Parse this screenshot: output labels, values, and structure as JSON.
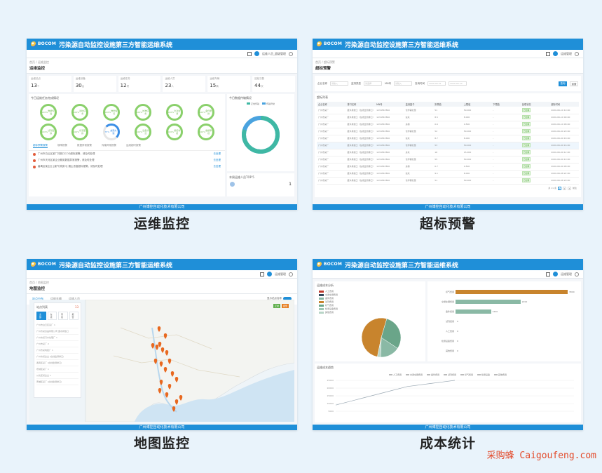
{
  "app_title": "污染源自动监控设施第三方智能运维系统",
  "logo_text": "BOCOM",
  "footer_text": "广州博控自动化技术有限公司",
  "watermark": "采购蜂 Caigoufeng.com",
  "panels": [
    {
      "caption": "运维监控",
      "breadcrumb": "首页 / 运维监控",
      "page_title": "运维监控",
      "user_name": "运维人员_超级管理",
      "stats": [
        {
          "label": "运维站点",
          "value": "13",
          "unit": "个"
        },
        {
          "label": "运维设备",
          "value": "30",
          "unit": "台"
        },
        {
          "label": "运维任务",
          "value": "12",
          "unit": "项"
        },
        {
          "label": "运维人员",
          "value": "23",
          "unit": "人"
        },
        {
          "label": "运维车辆",
          "value": "15",
          "unit": "辆"
        },
        {
          "label": "巡检次数",
          "value": "44",
          "unit": "次"
        }
      ],
      "rings_title": "今日运维任务完成情况",
      "rings": [
        {
          "pct": "100%",
          "label": "数据传输"
        },
        {
          "pct": "100%",
          "label": "巡检任务"
        },
        {
          "pct": "100%",
          "label": "维修保养"
        },
        {
          "pct": "100%",
          "label": "校准任务"
        },
        {
          "pct": "100%",
          "label": "比对监测"
        },
        {
          "pct": "100%",
          "label": "备件更换"
        },
        {
          "pct": "100%",
          "label": "试剂更换"
        },
        {
          "pct": "100%",
          "label": "标液更换"
        },
        {
          "pct": "75%",
          "label": "故障处理"
        },
        {
          "pct": "100%",
          "label": "设备清洗"
        },
        {
          "pct": "100%",
          "label": "质控考核"
        },
        {
          "pct": "100%",
          "label": "数据审核"
        }
      ],
      "donut_title": "今日数据传输情况",
      "donut_legend": [
        "正常传输",
        "传输异常"
      ],
      "rank_title": "本周运维人员TOP 5",
      "rank_value": "1",
      "tabs": [
        "超标预警报警",
        "故障报警",
        "数据异常报警",
        "传输异常报警",
        "运维超时报警"
      ],
      "alarms": [
        {
          "text": "广州市白云区某厂排放口COD超标报警，请及时处理",
          "link": "去处理"
        },
        {
          "text": "广州市天河区某企业氨氮数据异常报警，请及时处理",
          "link": "去处理"
        },
        {
          "text": "番禺区某企业 [废气排放口] 烟尘浓度超标报警，请及时处理",
          "link": "去处理"
        }
      ]
    },
    {
      "caption": "超标预警",
      "breadcrumb": "首页 / 超标预警",
      "page_title": "超标预警",
      "user_name": "运维管理",
      "filters": [
        {
          "label": "企业名称",
          "placeholder": "请输入"
        },
        {
          "label": "监测类型",
          "placeholder": "请选择"
        },
        {
          "label": "MN号",
          "placeholder": "请输入"
        },
        {
          "label": "查询时间",
          "placeholder": "2020-06-01"
        }
      ],
      "date_end": "2020-06-10",
      "search_btn": "查询",
      "reset_btn": "重置",
      "table_title": "超标列表",
      "columns": [
        "企业名称",
        "排口名称",
        "MN号",
        "监测因子",
        "折算值",
        "上限值",
        "下限值",
        "处理状态",
        "超标时间"
      ],
      "rows": [
        [
          "广州市某厂",
          "废水排放口（在线监测排口）",
          "1234567890",
          "化学需氧量",
          "51",
          "50.000",
          "-",
          "已处理",
          "2020-06-10 10:00"
        ],
        [
          "广州市某厂",
          "废水排放口（在线监测排口）",
          "1234567890",
          "氨氮",
          "8.5",
          "8.000",
          "-",
          "已处理",
          "2020-06-10 09:00"
        ],
        [
          "广州市某厂",
          "废水排放口（在线监测排口）",
          "1234567890",
          "总磷",
          "0.6",
          "0.500",
          "-",
          "已处理",
          "2020-06-10 08:00"
        ],
        [
          "广州市某厂",
          "废水排放口（在线监测排口）",
          "1234567890",
          "化学需氧量",
          "52",
          "50.000",
          "-",
          "已处理",
          "2020-06-09 20:00"
        ],
        [
          "广州市某厂",
          "废水排放口（在线监测排口）",
          "1234567890",
          "氨氮",
          "8.7",
          "8.000",
          "-",
          "已处理",
          "2020-06-09 18:00"
        ],
        [
          "广州市某厂",
          "废水排放口（在线监测排口）",
          "1234567890",
          "化学需氧量",
          "53",
          "50.000",
          "-",
          "已处理",
          "2020-06-09 16:00"
        ],
        [
          "广州市某厂",
          "废水排放口（在线监测排口）",
          "1234567890",
          "总氮",
          "16",
          "15.000",
          "-",
          "已处理",
          "2020-06-09 12:00"
        ],
        [
          "广州市某厂",
          "废水排放口（在线监测排口）",
          "1234567890",
          "化学需氧量",
          "55",
          "50.000",
          "-",
          "已处理",
          "2020-06-09 10:00"
        ],
        [
          "广州市某厂",
          "废水排放口（在线监测排口）",
          "1234567890",
          "总磷",
          "0.7",
          "0.500",
          "-",
          "已处理",
          "2020-06-09 08:00"
        ],
        [
          "广州市某厂",
          "废水排放口（在线监测排口）",
          "1234567890",
          "氨氮",
          "9.1",
          "8.000",
          "-",
          "已处理",
          "2020-06-08 22:00"
        ],
        [
          "广州市某厂",
          "废水排放口（在线监测排口）",
          "1234567890",
          "化学需氧量",
          "51",
          "50.000",
          "-",
          "已处理",
          "2020-06-08 20:00"
        ]
      ],
      "pager_total": "共 11 条",
      "pager_pages": [
        "1",
        "2",
        "3"
      ],
      "pager_jump": "前往"
    },
    {
      "caption": "地图监控",
      "breadcrumb": "首页 / 地图监控",
      "page_title": "地图监控",
      "user_name": "运维管理",
      "tabs": [
        "站点分布",
        "运维车辆",
        "运维人员"
      ],
      "toggle_label": "显示站点名称",
      "list_title": "站点列表",
      "list_count": "13",
      "list_tabs": [
        "全部",
        "在线",
        "离线",
        "报警"
      ],
      "list_items": [
        "广州市白云区某厂 1",
        "广州市某食品有限公司 废水排放口",
        "广州市某污水处理厂 1",
        "广州市某厂 2",
        "广州市某电镀厂 1",
        "广州市某企业 (在线监测排口)",
        "番禺区某厂 (在线监测排口)",
        "增城区某厂 1",
        "从化区某企业 1",
        "黄埔区某厂 (在线监测排口)"
      ],
      "map_btns": [
        "正常",
        "报警"
      ]
    },
    {
      "caption": "成本统计",
      "breadcrumb": "首页 / 成本统计",
      "page_title": "成本统计",
      "user_name": "运维管理",
      "pie_title": "运维成本分析",
      "legend": [
        {
          "label": "人工费用",
          "color": "#c0392b"
        },
        {
          "label": "交通车辆费用",
          "color": "#34495e"
        },
        {
          "label": "备件费用",
          "color": "#8ab9a5"
        },
        {
          "label": "试剂费用",
          "color": "#c8842d"
        },
        {
          "label": "标气费用",
          "color": "#6aa589"
        },
        {
          "label": "检测设备费用",
          "color": "#9fc7b4"
        },
        {
          "label": "其他费用",
          "color": "#b8d5c7"
        }
      ],
      "bars": [
        {
          "label": "标气费用",
          "value": 3800,
          "value_text": "3800",
          "color": "#c8842d"
        },
        {
          "label": "交通车辆费用",
          "value": 2200,
          "value_text": "2200",
          "color": "#8ab9a5"
        },
        {
          "label": "备件费用",
          "value": 1200,
          "value_text": "1200",
          "color": "#8ab9a5"
        },
        {
          "label": "试剂费用",
          "value": 0,
          "value_text": "0",
          "color": "#8ab9a5"
        },
        {
          "label": "人工费用",
          "value": 0,
          "value_text": "0",
          "color": "#8ab9a5"
        },
        {
          "label": "检测设备费用",
          "value": 0,
          "value_text": "0",
          "color": "#8ab9a5"
        },
        {
          "label": "其他费用",
          "value": 0,
          "value_text": "0",
          "color": "#8ab9a5"
        }
      ],
      "line_title": "运维成本趋势",
      "line_legend": [
        "人工费用",
        "交通车辆费用",
        "备件费用",
        "试剂费用",
        "标气费用",
        "检测设备",
        "其他费用"
      ],
      "line_yticks": [
        "25000",
        "20000",
        "15000",
        "10000",
        "5000"
      ]
    }
  ],
  "chart_data": [
    {
      "type": "pie",
      "title": "运维成本分析",
      "labels": [
        "标气费用",
        "交通车辆费用",
        "备件费用",
        "试剂费用"
      ],
      "values": [
        3800,
        2200,
        1200,
        200
      ]
    },
    {
      "type": "bar",
      "categories": [
        "标气费用",
        "交通车辆费用",
        "备件费用",
        "试剂费用",
        "人工费用",
        "检测设备费用",
        "其他费用"
      ],
      "values": [
        3800,
        2200,
        1200,
        0,
        0,
        0,
        0
      ]
    },
    {
      "type": "line",
      "title": "运维成本趋势",
      "x": [
        1,
        2,
        3,
        4,
        5,
        6
      ],
      "series": [
        {
          "name": "人工费用",
          "values": [
            5000,
            10000,
            15000,
            20000,
            22500,
            25000
          ]
        }
      ],
      "ylim": [
        0,
        25000
      ]
    }
  ]
}
